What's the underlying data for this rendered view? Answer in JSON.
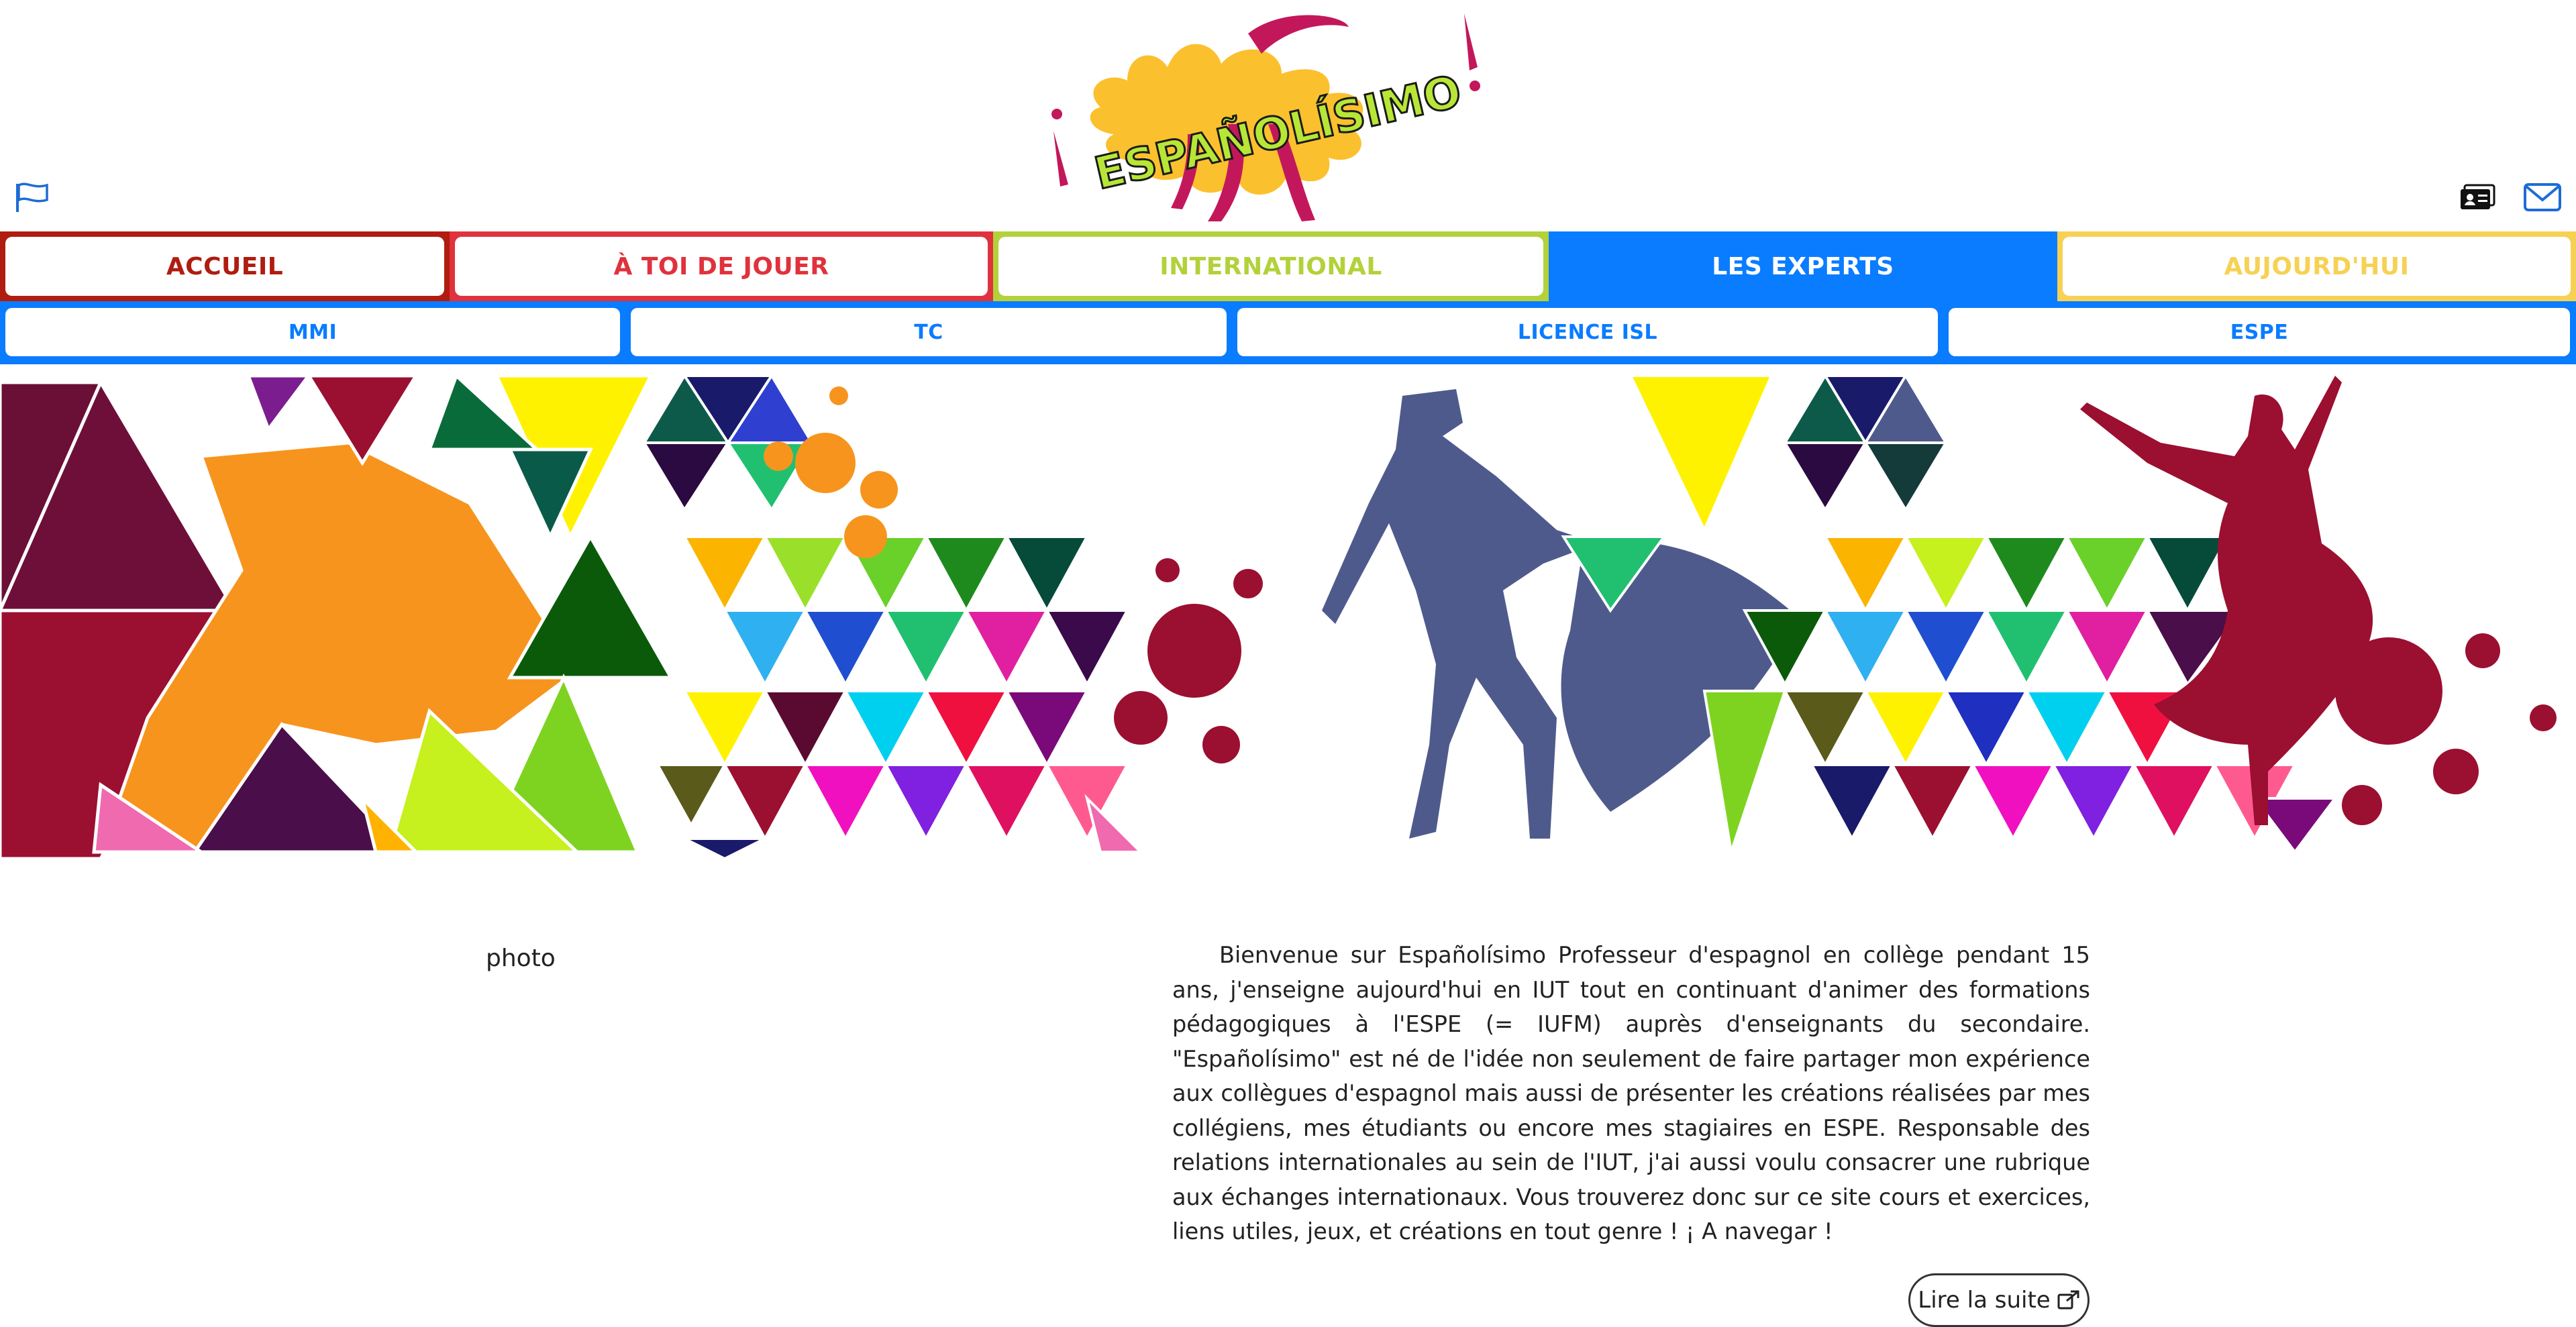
{
  "header": {
    "logo_text": "ESPAÑOLÍSIMO",
    "flag_icon": "flag-icon",
    "right_icons": [
      "id-card-icon",
      "mail-icon"
    ]
  },
  "nav": {
    "items": [
      {
        "label": "ACCUEIL",
        "color": "#b01c10"
      },
      {
        "label": "À TOI DE JOUER",
        "color": "#e0323c"
      },
      {
        "label": "INTERNATIONAL",
        "color": "#b3d13a"
      },
      {
        "label": "LES EXPERTS",
        "color": "#0a7cff",
        "active": true
      },
      {
        "label": "AUJOURD'HUI",
        "color": "#f7d154"
      }
    ]
  },
  "subnav": {
    "items": [
      {
        "label": "MMI"
      },
      {
        "label": "TC"
      },
      {
        "label": "LICENCE ISL"
      },
      {
        "label": "ESPE"
      }
    ]
  },
  "main": {
    "photo_alt": "photo",
    "intro": "Bienvenue sur Españolísimo Professeur d'espagnol en collège pendant 15 ans, j'enseigne aujourd'hui en IUT tout en continuant d'animer des formations pédagogiques à l'ESPE (= IUFM) auprès d'enseignants du secondaire. \"Españolísimo\" est né de l'idée non seulement de faire partager mon expérience aux collègues d'espagnol mais aussi de présenter les créations réalisées par mes collégiens, mes étudiants ou encore mes stagiaires en ESPE. Responsable des relations internationales au sein de l'IUT, j'ai aussi voulu consacrer une rubrique aux échanges internationaux. Vous trouverez donc sur ce site cours et exercices, liens utiles, jeux, et créations en tout genre ! ¡ A navegar !",
    "read_more": "Lire la suite"
  },
  "colors": {
    "primary_blue": "#0a7cff",
    "accueil": "#b01c10",
    "jouer": "#e0323c",
    "international": "#b3d13a",
    "aujourdhui": "#f7d154"
  }
}
